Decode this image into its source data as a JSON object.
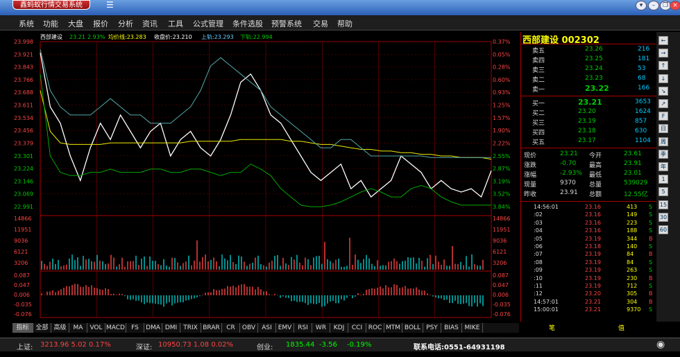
{
  "app_title": "鑫蚂蚁行情交易系统",
  "menu": [
    "系统",
    "功能",
    "大盘",
    "报价",
    "分析",
    "资讯",
    "工具",
    "公式管理",
    "条件选股",
    "预警系统",
    "交易",
    "帮助"
  ],
  "legend": {
    "stock": "西部建设",
    "last": "23.21",
    "change_pct": "2.93%",
    "avg_label": "均价线:23.283",
    "close_label": "收盘价:23.210",
    "upper_label": "上轨:23.293",
    "lower_label": "下轨:22.994"
  },
  "price_ticks": [
    "23.998",
    "23.921",
    "23.843",
    "23.766",
    "23.688",
    "23.611",
    "23.534",
    "23.456",
    "23.379",
    "23.301",
    "23.224",
    "23.146",
    "23.069",
    "22.991"
  ],
  "pct_ticks": [
    "0.37%",
    "0.05%",
    "0.28%",
    "0.60%",
    "0.93%",
    "1.25%",
    "1.57%",
    "1.90%",
    "2.22%",
    "2.55%",
    "2.87%",
    "3.19%",
    "3.52%",
    "3.84%"
  ],
  "volume_ticks": [
    "14866",
    "11951",
    "9036",
    "6121",
    "3206"
  ],
  "macd_ticks": [
    "0.087",
    "0.047",
    "0.006",
    "-0.035",
    "-0.076"
  ],
  "panel": {
    "title": "西部建设  002302",
    "asks": [
      [
        "卖五",
        "23.26",
        "216"
      ],
      [
        "卖四",
        "23.25",
        "181"
      ],
      [
        "卖三",
        "23.24",
        "53"
      ],
      [
        "卖二",
        "23.23",
        "68"
      ],
      [
        "卖一",
        "23.22",
        "166"
      ]
    ],
    "bids": [
      [
        "买一",
        "23.21",
        "3653"
      ],
      [
        "买二",
        "23.20",
        "1624"
      ],
      [
        "买三",
        "23.19",
        "857"
      ],
      [
        "买四",
        "23.18",
        "630"
      ],
      [
        "买五",
        "23.17",
        "1104"
      ]
    ],
    "stats": [
      [
        "现价",
        "23.21",
        "今开",
        "23.61"
      ],
      [
        "涨跌",
        "-0.70",
        "最高",
        "23.91"
      ],
      [
        "涨幅",
        "-2.93%",
        "最低",
        "23.01"
      ],
      [
        "现量",
        "9370",
        "总量",
        "539029"
      ],
      [
        "昨收",
        "23.91",
        "总额",
        "12.55亿"
      ]
    ],
    "ticks": [
      [
        "14:56:01",
        "23.16",
        "413",
        "S"
      ],
      [
        ":02",
        "23.16",
        "149",
        "S"
      ],
      [
        ":03",
        "23.16",
        "223",
        "S"
      ],
      [
        ":04",
        "23.16",
        "188",
        "S"
      ],
      [
        ":05",
        "23.19",
        "344",
        "B"
      ],
      [
        ":06",
        "23.18",
        "140",
        "S"
      ],
      [
        ":07",
        "23.19",
        "84",
        "B"
      ],
      [
        ":08",
        "23.19",
        "84",
        "S"
      ],
      [
        ":09",
        "23.19",
        "263",
        "S"
      ],
      [
        ":10",
        "23.19",
        "230",
        "B"
      ],
      [
        ":11",
        "23.19",
        "712",
        "S"
      ],
      [
        ":12",
        "23.20",
        "305",
        "B"
      ],
      [
        "14:57:01",
        "23.21",
        "304",
        "B"
      ],
      [
        "15:00:01",
        "23.21",
        "9370",
        "S"
      ]
    ],
    "tab_left": "笔",
    "tab_right": "值"
  },
  "side_buttons": [
    "←",
    "→",
    "↑",
    "↓",
    "↘",
    "↗",
    "F",
    "日",
    "周",
    "季",
    "年",
    "1",
    "5",
    "15",
    "30",
    "60"
  ],
  "indicator_tabs": [
    "指标",
    "全部",
    "高级",
    "MA",
    "VOL",
    "MACD",
    "FS",
    "DMA",
    "DMI",
    "TRIX",
    "BRAR",
    "CR",
    "OBV",
    "ASI",
    "EMV",
    "RSI",
    "WR",
    "KDJ",
    "CCI",
    "ROC",
    "MTM",
    "BOLL",
    "PSY",
    "BIAS",
    "MIKE"
  ],
  "status": {
    "sh_label": "上证:",
    "sh_value": "3213.96  5.02  0.17%",
    "sz_label": "深证:",
    "sz_value": "10950.73  1.08  0.02%",
    "cy_label": "创业:",
    "cy_value": "1835.44",
    "cy_change": "-3.56",
    "cy_pct": "-0.19%",
    "phone": "联系电话:0551-64931198"
  },
  "chart_data": {
    "type": "line",
    "title": "西部建设",
    "series": [
      {
        "name": "收盘价",
        "values": [
          23.93,
          23.6,
          23.5,
          23.3,
          23.15,
          23.35,
          23.5,
          23.4,
          23.55,
          23.45,
          23.35,
          23.45,
          23.5,
          23.3,
          23.4,
          23.45,
          23.35,
          23.3,
          23.4,
          23.55,
          23.75,
          23.8,
          23.7,
          23.55,
          23.5,
          23.4,
          23.3,
          23.2,
          23.15,
          23.2,
          23.25,
          23.1,
          23.15,
          23.05,
          23.1,
          23.15,
          23.3,
          23.25,
          23.2,
          23.1,
          23.15,
          23.1,
          23.08,
          23.1,
          23.05,
          23.21
        ]
      },
      {
        "name": "均价线",
        "values": [
          23.7,
          23.45,
          23.38,
          23.37,
          23.37,
          23.37,
          23.37,
          23.38,
          23.38,
          23.38,
          23.38,
          23.38,
          23.38,
          23.38,
          23.38,
          23.39,
          23.39,
          23.39,
          23.39,
          23.39,
          23.4,
          23.4,
          23.4,
          23.4,
          23.4,
          23.39,
          23.39,
          23.38,
          23.37,
          23.37,
          23.36,
          23.35,
          23.34,
          23.34,
          23.33,
          23.33,
          23.32,
          23.32,
          23.31,
          23.31,
          23.3,
          23.3,
          23.29,
          23.29,
          23.29,
          23.28
        ]
      },
      {
        "name": "上轨",
        "values": [
          23.95,
          23.7,
          23.6,
          23.55,
          23.55,
          23.55,
          23.6,
          23.65,
          23.6,
          23.55,
          23.55,
          23.5,
          23.5,
          23.5,
          23.55,
          23.6,
          23.7,
          23.85,
          23.9,
          23.85,
          23.8,
          23.75,
          23.7,
          23.6,
          23.55,
          23.5,
          23.45,
          23.4,
          23.35,
          23.35,
          23.4,
          23.4,
          23.35,
          23.3,
          23.3,
          23.3,
          23.3,
          23.3,
          23.3,
          23.29,
          23.29,
          23.29,
          23.29,
          23.29,
          23.29,
          23.29
        ]
      },
      {
        "name": "下轨",
        "values": [
          23.8,
          23.3,
          23.2,
          23.18,
          23.18,
          23.2,
          23.2,
          23.22,
          23.2,
          23.2,
          23.2,
          23.22,
          23.22,
          23.2,
          23.2,
          23.22,
          23.22,
          23.2,
          23.18,
          23.2,
          23.2,
          23.25,
          23.22,
          23.18,
          23.1,
          23.05,
          23.0,
          22.99,
          22.99,
          23.0,
          23.02,
          23.05,
          23.08,
          23.1,
          23.08,
          23.05,
          23.05,
          23.1,
          23.12,
          23.1,
          23.05,
          23.02,
          23.0,
          23.0,
          23.0,
          23.0
        ]
      }
    ]
  }
}
